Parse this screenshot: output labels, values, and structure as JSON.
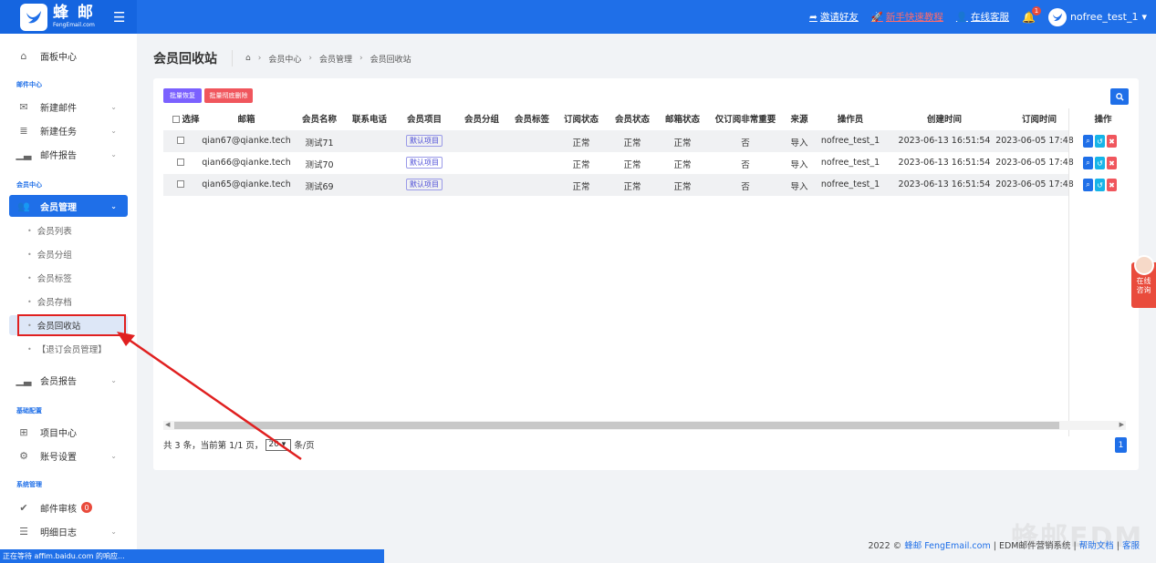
{
  "header": {
    "logo_cn": "蜂 邮",
    "logo_en": "FengEmail.com",
    "links": {
      "invite": "邀请好友",
      "tutorial": "新手快速教程",
      "support": "在线客服"
    },
    "notification_count": "1",
    "username": "nofree_test_1"
  },
  "sidebar": {
    "dashboard": "面板中心",
    "section_mail": "邮件中心",
    "new_mail": "新建邮件",
    "new_task": "新建任务",
    "mail_report": "邮件报告",
    "section_member": "会员中心",
    "member_mgmt": "会员管理",
    "subs": [
      "会员列表",
      "会员分组",
      "会员标签",
      "会员存档",
      "会员回收站",
      "【退订会员管理】"
    ],
    "member_report": "会员报告",
    "section_basic": "基础配置",
    "project_center": "项目中心",
    "account_settings": "账号设置",
    "section_system": "系统管理",
    "mail_review": "邮件审核",
    "mail_review_count": "0",
    "detail_log": "明细日志"
  },
  "page": {
    "title": "会员回收站",
    "breadcrumb": [
      "会员中心",
      "会员管理",
      "会员回收站"
    ]
  },
  "toolbar": {
    "restore": "批量恢复",
    "delete": "批量彻底删除"
  },
  "table": {
    "headers": [
      "选择",
      "邮箱",
      "会员名称",
      "联系电话",
      "会员项目",
      "会员分组",
      "会员标签",
      "订阅状态",
      "会员状态",
      "邮箱状态",
      "仅订阅非常重要",
      "来源",
      "操作员",
      "创建时间",
      "订阅时间",
      "操作"
    ],
    "rows": [
      {
        "email": "qian67@qianke.tech",
        "name": "测试71",
        "project": "默认项目",
        "sub": "正常",
        "member": "正常",
        "mailbox": "正常",
        "important": "否",
        "source": "导入",
        "operator": "nofree_test_1",
        "created": "2023-06-13 16:51:54",
        "subscribed": "2023-06-05 17:48"
      },
      {
        "email": "qian66@qianke.tech",
        "name": "测试70",
        "project": "默认项目",
        "sub": "正常",
        "member": "正常",
        "mailbox": "正常",
        "important": "否",
        "source": "导入",
        "operator": "nofree_test_1",
        "created": "2023-06-13 16:51:54",
        "subscribed": "2023-06-05 17:48"
      },
      {
        "email": "qian65@qianke.tech",
        "name": "测试69",
        "project": "默认项目",
        "sub": "正常",
        "member": "正常",
        "mailbox": "正常",
        "important": "否",
        "source": "导入",
        "operator": "nofree_test_1",
        "created": "2023-06-13 16:51:54",
        "subscribed": "2023-06-05 17:48"
      }
    ]
  },
  "pager": {
    "summary": "共 3 条，当前第 1/1 页，",
    "per_page": "20",
    "unit": "条/页",
    "current_page": "1"
  },
  "footer": {
    "prefix": "2022 © ",
    "brand": "蜂邮 FengEmail.com",
    "mid": " | EDM邮件营销系统 | ",
    "help": "帮助文档",
    "sep": " | ",
    "service": "客服"
  },
  "watermark": "蜂邮EDM",
  "status_bar": "正在等待 affim.baidu.com 的响应...",
  "chat": {
    "line1": "在线",
    "line2": "咨询"
  },
  "colors": {
    "primary": "#1f6fe8",
    "danger": "#f0565d",
    "purple": "#7b61ff"
  }
}
